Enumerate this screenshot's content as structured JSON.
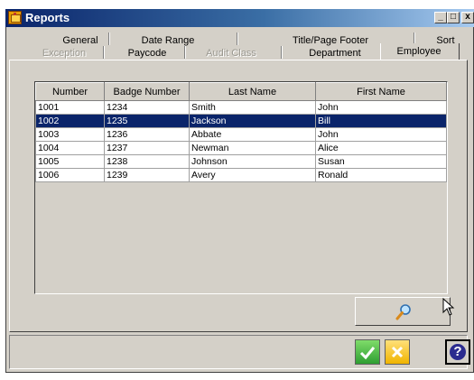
{
  "window": {
    "title": "Reports",
    "minimize": "_",
    "maximize": "□",
    "close": "x"
  },
  "tabs": {
    "row1": [
      "General",
      "Date Range",
      "Title/Page Footer",
      "Sort"
    ],
    "row2": [
      "Exception",
      "Paycode",
      "Audit Class",
      "Department",
      "Employee"
    ],
    "disabled": [
      "Exception",
      "Audit Class"
    ],
    "active": "Employee"
  },
  "grid": {
    "columns": [
      "Number",
      "Badge Number",
      "Last Name",
      "First Name"
    ],
    "rows": [
      [
        "1001",
        "1234",
        "Smith",
        "John"
      ],
      [
        "1002",
        "1235",
        "Jackson",
        "Bill"
      ],
      [
        "1003",
        "1236",
        "Abbate",
        "John"
      ],
      [
        "1004",
        "1237",
        "Newman",
        "Alice"
      ],
      [
        "1005",
        "1238",
        "Johnson",
        "Susan"
      ],
      [
        "1006",
        "1239",
        "Avery",
        "Ronald"
      ]
    ],
    "selected_row": 1
  },
  "buttons": {
    "search_icon": "magnifier-icon",
    "ok_icon": "checkmark-icon",
    "cancel_icon": "x-icon",
    "help_icon": "question-icon",
    "help_glyph": "?"
  },
  "colors": {
    "selection": "#0a246a",
    "ok": "#3ab03c",
    "cancel": "#f5c400",
    "help": "#2b2b8f"
  }
}
